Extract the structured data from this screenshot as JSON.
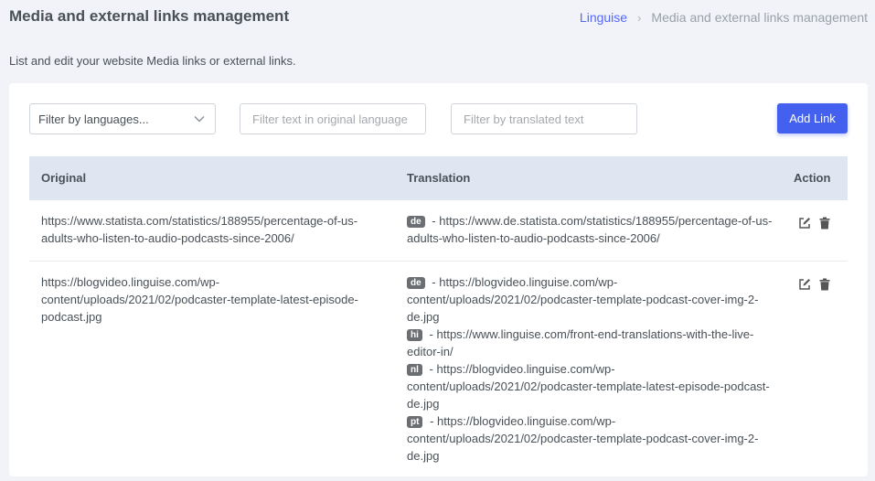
{
  "header": {
    "title": "Media and external links management",
    "breadcrumb": {
      "root": "Linguise",
      "separator": "›",
      "current": "Media and external links management"
    },
    "subtitle": "List and edit your website Media links or external links."
  },
  "filters": {
    "languages_selected": "Filter by languages...",
    "original_placeholder": "Filter text in original language",
    "translated_placeholder": "Filter by translated text",
    "add_button": "Add Link"
  },
  "table": {
    "columns": {
      "original": "Original",
      "translation": "Translation",
      "action": "Action"
    },
    "rows": [
      {
        "original": "https://www.statista.com/statistics/188955/percentage-of-us-adults-who-listen-to-audio-podcasts-since-2006/",
        "translations": [
          {
            "lang": "de",
            "url": "https://www.de.statista.com/statistics/188955/percentage-of-us-adults-who-listen-to-audio-podcasts-since-2006/"
          }
        ]
      },
      {
        "original": "https://blogvideo.linguise.com/wp-content/uploads/2021/02/podcaster-template-latest-episode-podcast.jpg",
        "translations": [
          {
            "lang": "de",
            "url": "https://blogvideo.linguise.com/wp-content/uploads/2021/02/podcaster-template-podcast-cover-img-2-de.jpg"
          },
          {
            "lang": "hi",
            "url": "https://www.linguise.com/front-end-translations-with-the-live-editor-in/"
          },
          {
            "lang": "nl",
            "url": "https://blogvideo.linguise.com/wp-content/uploads/2021/02/podcaster-template-latest-episode-podcast-de.jpg"
          },
          {
            "lang": "pt",
            "url": "https://blogvideo.linguise.com/wp-content/uploads/2021/02/podcaster-template-podcast-cover-img-2-de.jpg"
          }
        ]
      }
    ],
    "dash": "-"
  },
  "icons": {
    "edit": "edit-icon",
    "delete": "trash-icon",
    "dropdown": "chevron-down-icon"
  },
  "colors": {
    "accent": "#4361ee",
    "header_bg": "#dfe6f2",
    "badge": "#6b6f73",
    "link": "#5468ff"
  }
}
